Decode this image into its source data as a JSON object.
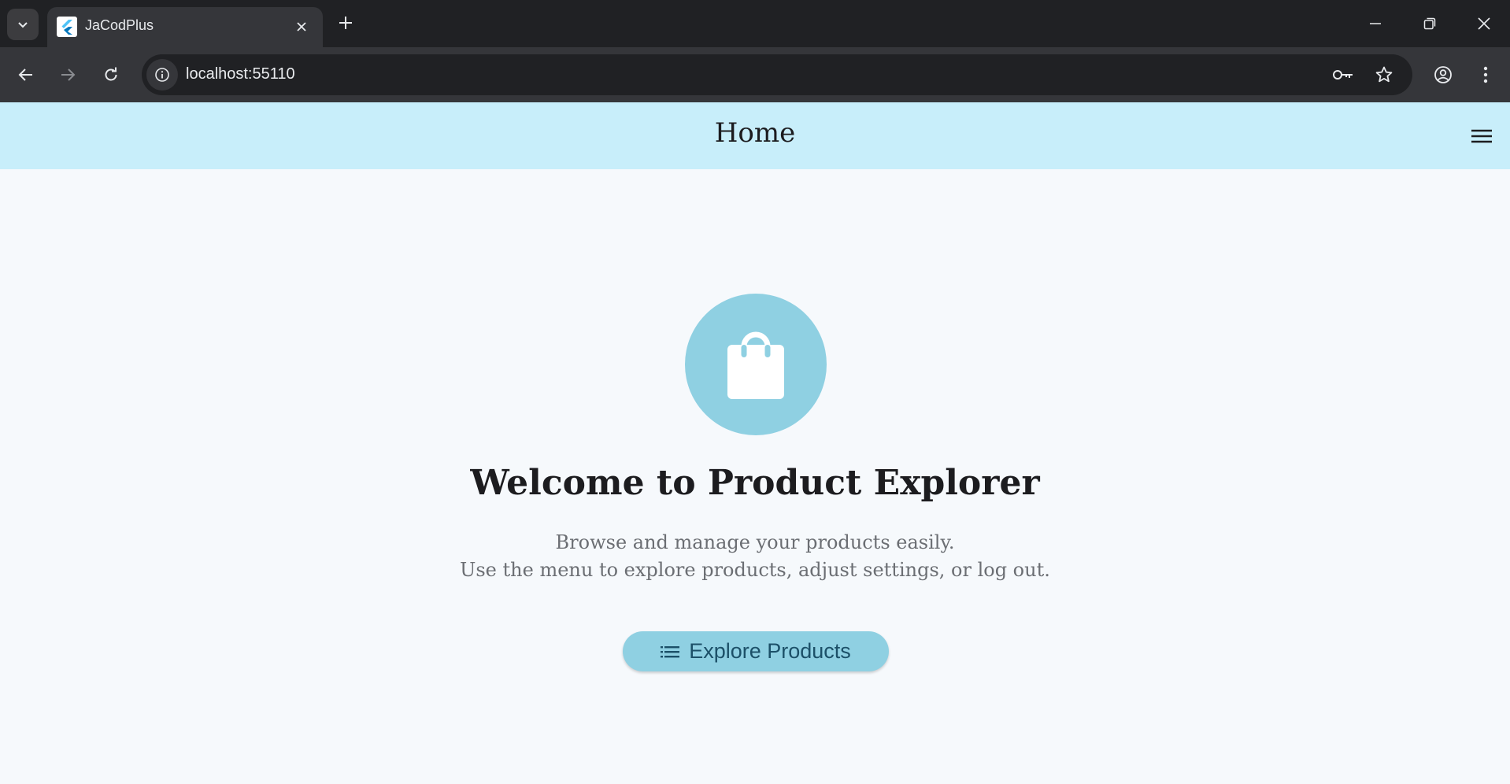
{
  "browser": {
    "tab": {
      "title": "JaCodPlus"
    },
    "address_bar": {
      "url": "localhost:55110"
    }
  },
  "app": {
    "header": {
      "title": "Home"
    },
    "hero": {
      "headline": "Welcome to Product Explorer",
      "description_lines": [
        "Browse and manage your products easily.",
        "Use the menu to explore products, adjust settings, or log out."
      ],
      "cta_label": "Explore Products"
    }
  },
  "colors": {
    "app_bar": "#c8eefa",
    "accent": "#8fd0e2",
    "background": "#f6f9fc",
    "cta_text": "#1c5068"
  }
}
